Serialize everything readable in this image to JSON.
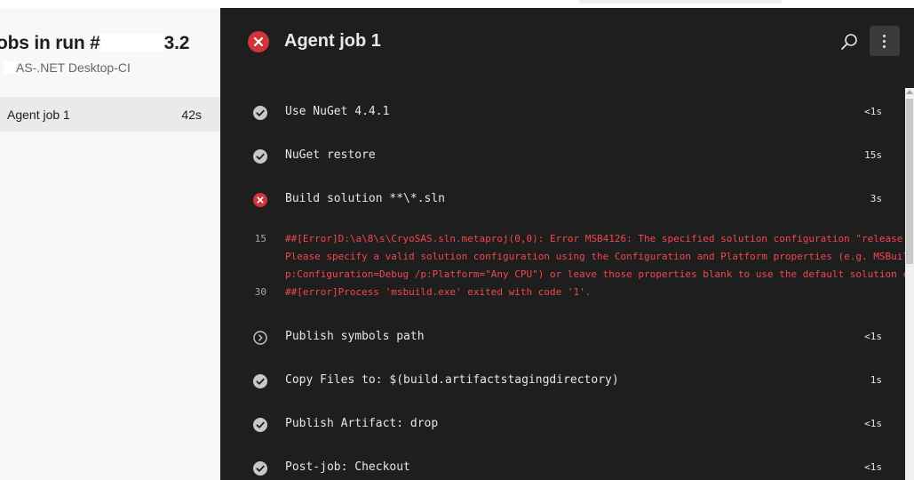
{
  "left_panel": {
    "title_prefix": "obs in run #",
    "title_suffix": "3.2",
    "subtitle": "AS-.NET Desktop-CI",
    "jobs": [
      {
        "name": "Agent job 1",
        "duration": "42s"
      }
    ]
  },
  "job_header": {
    "status": "failed",
    "title": "Agent job 1"
  },
  "steps": [
    {
      "status": "succeeded",
      "label": "Use NuGet 4.4.1",
      "duration": "<1s"
    },
    {
      "status": "succeeded",
      "label": "NuGet restore",
      "duration": "15s"
    },
    {
      "status": "failed",
      "label": "Build solution **\\*.sln",
      "duration": "3s"
    },
    {
      "status": "skipped",
      "label": "Publish symbols path",
      "duration": "<1s"
    },
    {
      "status": "succeeded",
      "label": "Copy Files to: $(build.artifactstagingdirectory)",
      "duration": "1s"
    },
    {
      "status": "succeeded",
      "label": "Publish Artifact: drop",
      "duration": "<1s"
    },
    {
      "status": "succeeded",
      "label": "Post-job: Checkout",
      "duration": "<1s"
    }
  ],
  "error_log": [
    {
      "line": "15",
      "text": "##[Error]D:\\a\\8\\s\\CryoSAS.sln.metaproj(0,0): Error MSB4126: The specified solution configuration \"release|"
    },
    {
      "line": "",
      "text": "Please specify a valid solution configuration using the Configuration and Platform properties (e.g. MSBuil"
    },
    {
      "line": "",
      "text": "p:Configuration=Debug /p:Platform=\"Any CPU\") or leave those properties blank to use the default solution c"
    },
    {
      "line": "30",
      "text": "##[error]Process 'msbuild.exe' exited with code '1'."
    }
  ],
  "icons": {
    "succeeded": "check-circle-icon",
    "failed": "error-circle-icon",
    "skipped": "chevron-circle-icon",
    "search": "search-icon",
    "more": "more-vertical-icon"
  },
  "colors": {
    "success": "#c8c8c8",
    "error": "#d13438",
    "error_text": "#f0484f",
    "panel_dark": "#1e1e1e"
  }
}
